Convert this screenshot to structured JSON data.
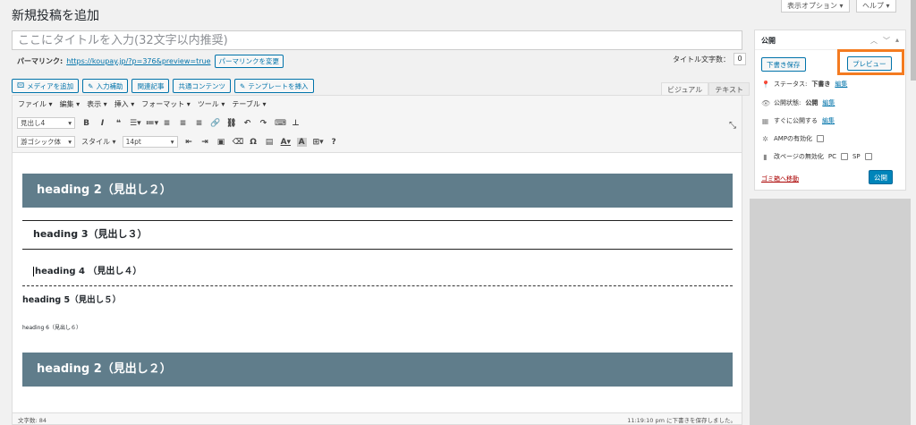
{
  "page_title": "新規投稿を追加",
  "top_buttons": {
    "screen_options": "表示オプション ▾",
    "help": "ヘルプ ▾"
  },
  "title_input": {
    "placeholder": "ここにタイトルを入力(32文字以内推奨)"
  },
  "permalink": {
    "label": "パーマリンク:",
    "url": "https://koupay.jp/?p=376&preview=true",
    "button": "パーマリンクを変更"
  },
  "title_count": {
    "label": "タイトル文字数：",
    "value": "0"
  },
  "media_buttons": [
    {
      "icon": "media-icon",
      "label": "メディアを追加"
    },
    {
      "icon": "pencil-icon",
      "label": "入力補助"
    },
    {
      "icon": "",
      "label": "関連記事"
    },
    {
      "icon": "",
      "label": "共通コンテンツ"
    },
    {
      "icon": "pencil-icon",
      "label": "テンプレートを挿入"
    }
  ],
  "editor_tabs": {
    "visual": "ビジュアル",
    "text": "テキスト"
  },
  "menu": [
    "ファイル ▾",
    "編集 ▾",
    "表示 ▾",
    "挿入 ▾",
    "フォーマット ▾",
    "ツール ▾",
    "テーブル ▾"
  ],
  "toolbar": {
    "block_format": "見出し4",
    "font_family": "游ゴシック体",
    "style": "スタイル ▾",
    "font_size": "14pt"
  },
  "content": {
    "h2_first": "heading 2（見出し２）",
    "h3": "heading 3（見出し３）",
    "h4": "heading 4 （見出し４）",
    "h5": "heading 5（見出し５）",
    "h6": "heading 6（見出し６）",
    "h2_second": "heading 2（見出し２）"
  },
  "statusbar": {
    "word_count": "文字数: 84",
    "saved": "11:19:10 pm に下書きを保存しました。"
  },
  "publish_box": {
    "title": "公開",
    "save_draft": "下書き保存",
    "preview": "プレビュー",
    "status_label": "ステータス: ",
    "status_value": "下書き",
    "edit": "編集",
    "visibility_label": "公開状態: ",
    "visibility_value": "公開",
    "schedule_label": "すぐに公開する",
    "amp_label": "AMPの有効化",
    "pagebreak_label": "改ページの無効化",
    "pc": "PC",
    "sp": "SP",
    "trash": "ゴミ箱へ移動",
    "publish": "公開"
  },
  "colors": {
    "heading_bg": "#607d8b",
    "primary": "#0085ba",
    "highlight": "#f47b20"
  }
}
